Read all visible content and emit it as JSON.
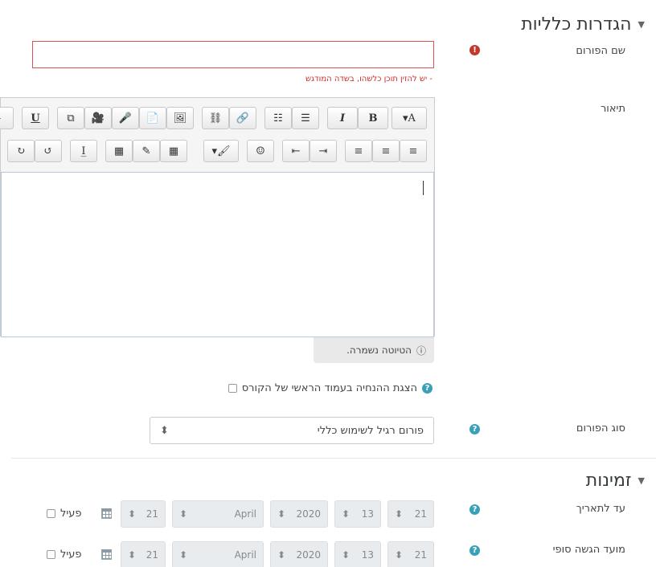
{
  "section_general": {
    "title": "הגדרות כלליות",
    "caret": "▼"
  },
  "forum_name": {
    "label": "שם הפורום",
    "value": "",
    "error": "- יש להזין תוכן כלשהו, בשדה המודגש",
    "error_icon": "!"
  },
  "description": {
    "label": "תיאור",
    "draft_status": "הטיוטה נשמרה.",
    "draft_icon": "ⓘ"
  },
  "toolbar": {
    "row1": [
      "▾A",
      "B",
      "I",
      "☰",
      "☷",
      "🔗",
      "⛓",
      "🖼",
      "📄",
      "🎤",
      "🎥",
      "⧉",
      "U",
      "-"
    ],
    "row2": [
      "≡",
      "≡",
      "≡",
      "⇥",
      "⇤",
      "☺",
      "▾🖌",
      "▦",
      "✎",
      "▦",
      "I̲",
      "↺",
      "↻"
    ]
  },
  "display_description": {
    "label": "הצגת ההנחיה בעמוד הראשי של הקורס",
    "help": "?"
  },
  "forum_type": {
    "label": "סוג הפורום",
    "selected": "פורום רגיל לשימוש כללי",
    "arrows": "⬍",
    "help": "?"
  },
  "section_availability": {
    "title": "זמינות",
    "caret": "▼"
  },
  "due_date": {
    "label": "עד לתאריך",
    "help": "?",
    "day": "21",
    "hour": "13",
    "year": "2020",
    "month": "April",
    "minute": "21",
    "enable_label": "פעיל",
    "arrows": "⬍"
  },
  "cutoff_date": {
    "label": "מועד הגשה סופי",
    "help": "?",
    "day": "21",
    "hour": "13",
    "year": "2020",
    "month": "April",
    "minute": "21",
    "enable_label": "פעיל",
    "arrows": "⬍"
  },
  "colors": {
    "help": "#3aa0b8",
    "error": "#c0392b",
    "error_border": "#d9534f"
  }
}
